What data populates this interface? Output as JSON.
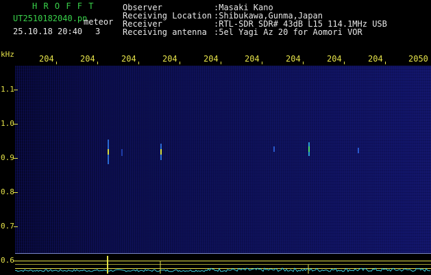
{
  "header": {
    "app_title": "H R O F F T",
    "filename": "UT2510182040.pn",
    "mode_label": "meteor",
    "datetime": "25.10.18 20:40",
    "count": "3",
    "observer_label": "Observer",
    "observer_value": ":Masaki Kano",
    "location_label": "Receiving Location",
    "location_value": ":Shibukawa,Gunma,Japan",
    "receiver_label": "Receiver",
    "receiver_value": ":RTL-SDR SDR# 43dB L15 114.1MHz USB",
    "antenna_label": "Receiving antenna",
    "antenna_value": ":5el Yagi Az 20 for Aomori VOR"
  },
  "time_axis": {
    "labels": [
      "204",
      "204",
      "204",
      "204",
      "204",
      "204",
      "204",
      "204",
      "204",
      "2050"
    ]
  },
  "freq_axis": {
    "unit": "kHz",
    "labels": [
      "1.1",
      "1.0",
      "0.9",
      "0.8",
      "0.7",
      "0.6"
    ]
  },
  "colors": {
    "title_green": "#39d24a",
    "axis_yellow": "#e6e34a",
    "text_white": "#e8e8e8",
    "waterfall_blue": "#0d1050",
    "spectrum_cyan": "#3fd0e0"
  }
}
